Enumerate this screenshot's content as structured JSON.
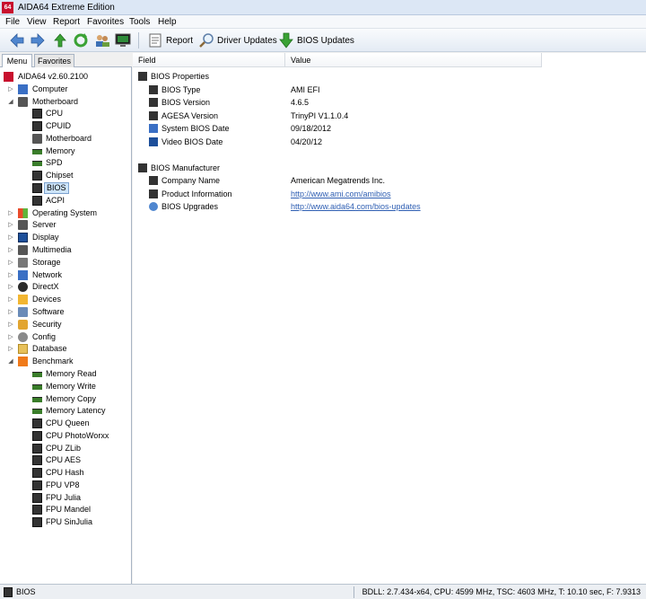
{
  "window": {
    "title": "AIDA64 Extreme Edition",
    "icon_text": "64"
  },
  "menu": [
    "File",
    "View",
    "Report",
    "Favorites",
    "Tools",
    "Help"
  ],
  "toolbar": {
    "report_label": "Report",
    "driver_updates_label": "Driver Updates",
    "bios_updates_label": "BIOS Updates"
  },
  "sidebar": {
    "tabs": [
      "Menu",
      "Favorites"
    ],
    "tree": [
      {
        "label": "AIDA64 v2.60.2100",
        "icon": "aida64-icon"
      },
      {
        "label": "Computer",
        "icon": "computer-icon"
      },
      {
        "label": "Motherboard",
        "icon": "motherboard-icon"
      },
      {
        "label": "CPU",
        "icon": "cpu-icon"
      },
      {
        "label": "CPUID",
        "icon": "cpuid-icon"
      },
      {
        "label": "Motherboard",
        "icon": "motherboard-icon"
      },
      {
        "label": "Memory",
        "icon": "memory-icon"
      },
      {
        "label": "SPD",
        "icon": "spd-icon"
      },
      {
        "label": "Chipset",
        "icon": "chipset-icon"
      },
      {
        "label": "BIOS",
        "icon": "bios-icon"
      },
      {
        "label": "ACPI",
        "icon": "acpi-icon"
      },
      {
        "label": "Operating System",
        "icon": "windows-icon"
      },
      {
        "label": "Server",
        "icon": "server-icon"
      },
      {
        "label": "Display",
        "icon": "display-icon"
      },
      {
        "label": "Multimedia",
        "icon": "multimedia-icon"
      },
      {
        "label": "Storage",
        "icon": "storage-icon"
      },
      {
        "label": "Network",
        "icon": "network-icon"
      },
      {
        "label": "DirectX",
        "icon": "directx-icon"
      },
      {
        "label": "Devices",
        "icon": "devices-icon"
      },
      {
        "label": "Software",
        "icon": "software-icon"
      },
      {
        "label": "Security",
        "icon": "security-icon"
      },
      {
        "label": "Config",
        "icon": "config-icon"
      },
      {
        "label": "Database",
        "icon": "database-icon"
      },
      {
        "label": "Benchmark",
        "icon": "benchmark-icon"
      },
      {
        "label": "Memory Read",
        "icon": "ram-icon"
      },
      {
        "label": "Memory Write",
        "icon": "ram-icon"
      },
      {
        "label": "Memory Copy",
        "icon": "ram-icon"
      },
      {
        "label": "Memory Latency",
        "icon": "ram-icon"
      },
      {
        "label": "CPU Queen",
        "icon": "chip-icon"
      },
      {
        "label": "CPU PhotoWorxx",
        "icon": "chip-icon"
      },
      {
        "label": "CPU ZLib",
        "icon": "chip-icon"
      },
      {
        "label": "CPU AES",
        "icon": "chip-icon"
      },
      {
        "label": "CPU Hash",
        "icon": "chip-icon"
      },
      {
        "label": "FPU VP8",
        "icon": "chip-icon"
      },
      {
        "label": "FPU Julia",
        "icon": "chip-icon"
      },
      {
        "label": "FPU Mandel",
        "icon": "chip-icon"
      },
      {
        "label": "FPU SinJulia",
        "icon": "chip-icon"
      }
    ]
  },
  "grid": {
    "columns": [
      "Field",
      "Value"
    ],
    "rows": [
      {
        "field": "BIOS Properties",
        "value": ""
      },
      {
        "field": "BIOS Type",
        "value": "AMI EFI"
      },
      {
        "field": "BIOS Version",
        "value": "4.6.5"
      },
      {
        "field": "AGESA Version",
        "value": "TrinyPI V1.1.0.4"
      },
      {
        "field": "System BIOS Date",
        "value": "09/18/2012"
      },
      {
        "field": "Video BIOS Date",
        "value": "04/20/12"
      },
      {
        "field": "BIOS Manufacturer",
        "value": ""
      },
      {
        "field": "Company Name",
        "value": "American Megatrends Inc."
      },
      {
        "field": "Product Information",
        "value": "http://www.ami.com/amibios"
      },
      {
        "field": "BIOS Upgrades",
        "value": "http://www.aida64.com/bios-updates"
      }
    ]
  },
  "status": {
    "left": "BIOS",
    "right": "BDLL: 2.7.434-x64, CPU: 4599 MHz, TSC: 4603 MHz, T: 10.10 sec, F: 7.9313"
  }
}
